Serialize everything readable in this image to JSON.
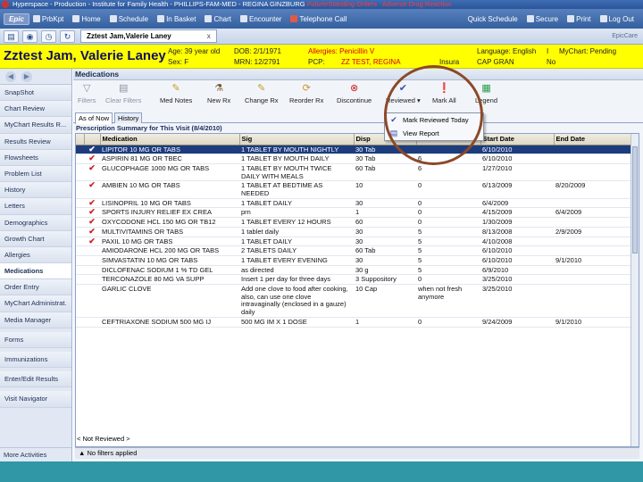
{
  "titlebar": {
    "text": "Hyperspace - Production - Institute for Family Health - PHILLIPS-FAM-MED - REGINA GINZBURG",
    "alert1": "Future/Standing Orders",
    "alert2": "Adverse Drug Reaction"
  },
  "menubar": {
    "epic": "Epic",
    "items": [
      "PrbKpt",
      "Home",
      "Schedule",
      "In Basket",
      "Chart",
      "Encounter",
      "Telephone Call"
    ],
    "right_items": [
      "Quick Schedule",
      "Secure",
      "Print",
      "Log Out"
    ]
  },
  "tabrow": {
    "patient_tab": "Zztest Jam,Valerie Laney",
    "close": "x",
    "epiccare": "EpicCare"
  },
  "banner": {
    "name": "Zztest Jam, Valerie Laney",
    "age": "Age: 39 year old",
    "sex": "Sex: F",
    "dob": "DOB: 2/1/1971",
    "mrn": "MRN: 12/2791",
    "allergies": "Allergies: Penicillin V",
    "pcp": "PCP:",
    "pcp_value": "ZZ TEST, REGINA",
    "insurance": "Insura",
    "language": "Language: English",
    "coverage": "CAP GRAN",
    "interp": "No",
    "mychart": "MyChart: Pending",
    "i_label": "I"
  },
  "sidebar": {
    "items": [
      "SnapShot",
      "Chart Review",
      "MyChart Results R...",
      "Results Review",
      "Flowsheets",
      "Problem List",
      "History",
      "Letters",
      "Demographics",
      "Growth Chart",
      "Allergies",
      "Medications",
      "Order Entry",
      "MyChart Administrat.",
      "Media Manager",
      "Forms",
      "Immunizations",
      "Enter/Edit Results",
      "Visit Navigator"
    ],
    "active": "Medications",
    "more": "More Activities"
  },
  "main": {
    "title": "Medications",
    "toolbar": {
      "filters": "Filters",
      "clear_filters": "Clear Filters",
      "med_notes": "Med Notes",
      "new_rx": "New Rx",
      "change_rx": "Change Rx",
      "reorder_rx": "Reorder Rx",
      "discontinue": "Discontinue",
      "reviewed": "Reviewed",
      "mark_all": "Mark All",
      "legend": "Legend"
    },
    "subtabs": [
      "As of Now",
      "History"
    ],
    "dropdown": [
      "Mark Reviewed Today",
      "View Report"
    ],
    "summary": "Prescription Summary for This Visit (8/4/2010)",
    "columns": [
      "",
      "",
      "Medication",
      "Sig",
      "Disp",
      "Refills",
      "Start Date",
      "End Date"
    ],
    "rows": [
      {
        "check": "✔",
        "med": "LIPITOR 10 MG OR TABS",
        "sig": "1 TABLET BY MOUTH NIGHTLY",
        "disp": "30 Tab",
        "refills": "",
        "start": "6/10/2010",
        "end": ""
      },
      {
        "check": "✔",
        "med": "ASPIRIN 81 MG OR TBEC",
        "sig": "1 TABLET BY MOUTH DAILY",
        "disp": "30 Tab",
        "refills": "6",
        "start": "6/10/2010",
        "end": ""
      },
      {
        "check": "✔",
        "med": "GLUCOPHAGE 1000 MG OR TABS",
        "sig": "1 TABLET BY MOUTH TWICE DAILY WITH MEALS",
        "disp": "60 Tab",
        "refills": "6",
        "start": "1/27/2010",
        "end": ""
      },
      {
        "check": "✔",
        "med": "AMBIEN 10 MG OR TABS",
        "sig": "1 TABLET AT BEDTIME AS NEEDED",
        "disp": "10",
        "refills": "0",
        "start": "6/13/2009",
        "end": "8/20/2009"
      },
      {
        "check": "✔",
        "med": "LISINOPRIL 10 MG OR TABS",
        "sig": "1 TABLET DAILY",
        "disp": "30",
        "refills": "0",
        "start": "6/4/2009",
        "end": ""
      },
      {
        "check": "✔",
        "med": "SPORTS INJURY RELIEF EX CREA",
        "sig": "prn",
        "disp": "1",
        "refills": "0",
        "start": "4/15/2009",
        "end": "6/4/2009"
      },
      {
        "check": "✔",
        "med": "OXYCODONE HCL 150 MG OR TB12",
        "sig": "1 TABLET EVERY 12 HOURS",
        "disp": "60",
        "refills": "0",
        "start": "1/30/2009",
        "end": ""
      },
      {
        "check": "✔",
        "med": "MULTIVITAMINS OR TABS",
        "sig": "1 tablet daily",
        "disp": "30",
        "refills": "5",
        "start": "8/13/2008",
        "end": "2/9/2009"
      },
      {
        "check": "✔",
        "med": "PAXIL 10 MG OR TABS",
        "sig": "1 TABLET DAILY",
        "disp": "30",
        "refills": "5",
        "start": "4/10/2008",
        "end": ""
      },
      {
        "check": "",
        "med": "AMIODARONE HCL 200 MG OR TABS",
        "sig": "2 TABLETS DAILY",
        "disp": "60 Tab",
        "refills": "5",
        "start": "6/10/2010",
        "end": ""
      },
      {
        "check": "",
        "med": "SIMVASTATIN 10 MG OR TABS",
        "sig": "1 TABLET EVERY EVENING",
        "disp": "30",
        "refills": "5",
        "start": "6/10/2010",
        "end": "9/1/2010"
      },
      {
        "check": "",
        "med": "DICLOFENAC SODIUM 1 % TD GEL",
        "sig": "as directed",
        "disp": "30 g",
        "refills": "5",
        "start": "6/9/2010",
        "end": ""
      },
      {
        "check": "",
        "med": "TERCONAZOLE 80 MG VA SUPP",
        "sig": "Insert 1 per day for three days",
        "disp": "3 Suppository",
        "refills": "0",
        "start": "3/25/2010",
        "end": ""
      },
      {
        "check": "",
        "med": "GARLIC CLOVE",
        "sig": "Add one clove to food after cooking, also, can use one clove intravaginally (enclosed in a gauze) daily",
        "disp": "10 Cap",
        "refills": "when not fresh anymore",
        "start": "3/25/2010",
        "end": ""
      },
      {
        "check": "",
        "med": "CEFTRIAXONE SODIUM 500 MG IJ",
        "sig": "500 MG IM X 1 DOSE",
        "disp": "1",
        "refills": "0",
        "start": "9/24/2009",
        "end": "9/1/2010"
      }
    ],
    "status1": "< Not Reviewed >",
    "status2": "No filters applied"
  }
}
